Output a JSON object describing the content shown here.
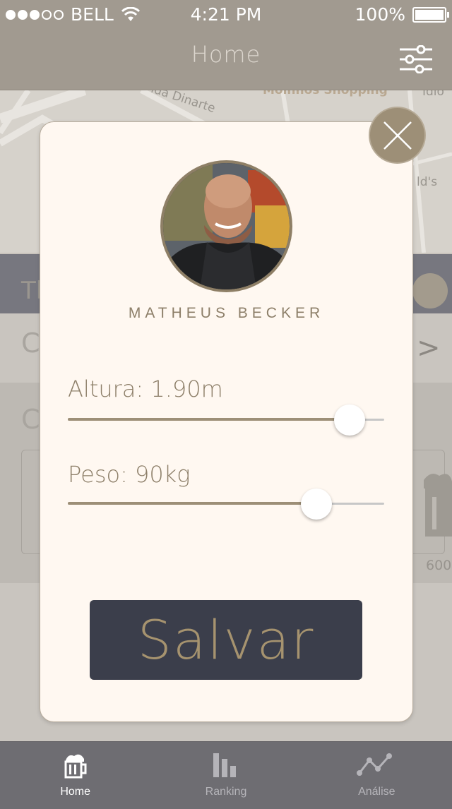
{
  "status_bar": {
    "carrier": "BELL",
    "time": "4:21 PM",
    "battery": "100%",
    "signal_bars_filled": 3,
    "signal_bars_total": 5
  },
  "nav": {
    "title": "Home",
    "filter_icon": "sliders-icon"
  },
  "map": {
    "labels": [
      "Moinhos Shopping",
      "ida Dinarte",
      "ld's",
      "Idio"
    ]
  },
  "background": {
    "section_text": "Th",
    "card_value": "600"
  },
  "modal": {
    "close_icon": "close-icon",
    "avatar_icon": "avatar-photo",
    "name": "MATHEUS BECKER",
    "height_label": "Altura: 1.90m",
    "height_fraction": 0.89,
    "weight_label": "Peso: 90kg",
    "weight_fraction": 0.785,
    "save_label": "Salvar"
  },
  "tabs": [
    {
      "label": "Home",
      "icon": "beer-mug-icon",
      "active": true
    },
    {
      "label": "Ranking",
      "icon": "bar-chart-icon",
      "active": false
    },
    {
      "label": "Análise",
      "icon": "line-graph-icon",
      "active": false
    }
  ],
  "colors": {
    "accent": "#9d8f77",
    "modal_bg": "#fff8f1",
    "button_bg": "#3b3e4b",
    "tab_bar": "#6e6d72"
  }
}
